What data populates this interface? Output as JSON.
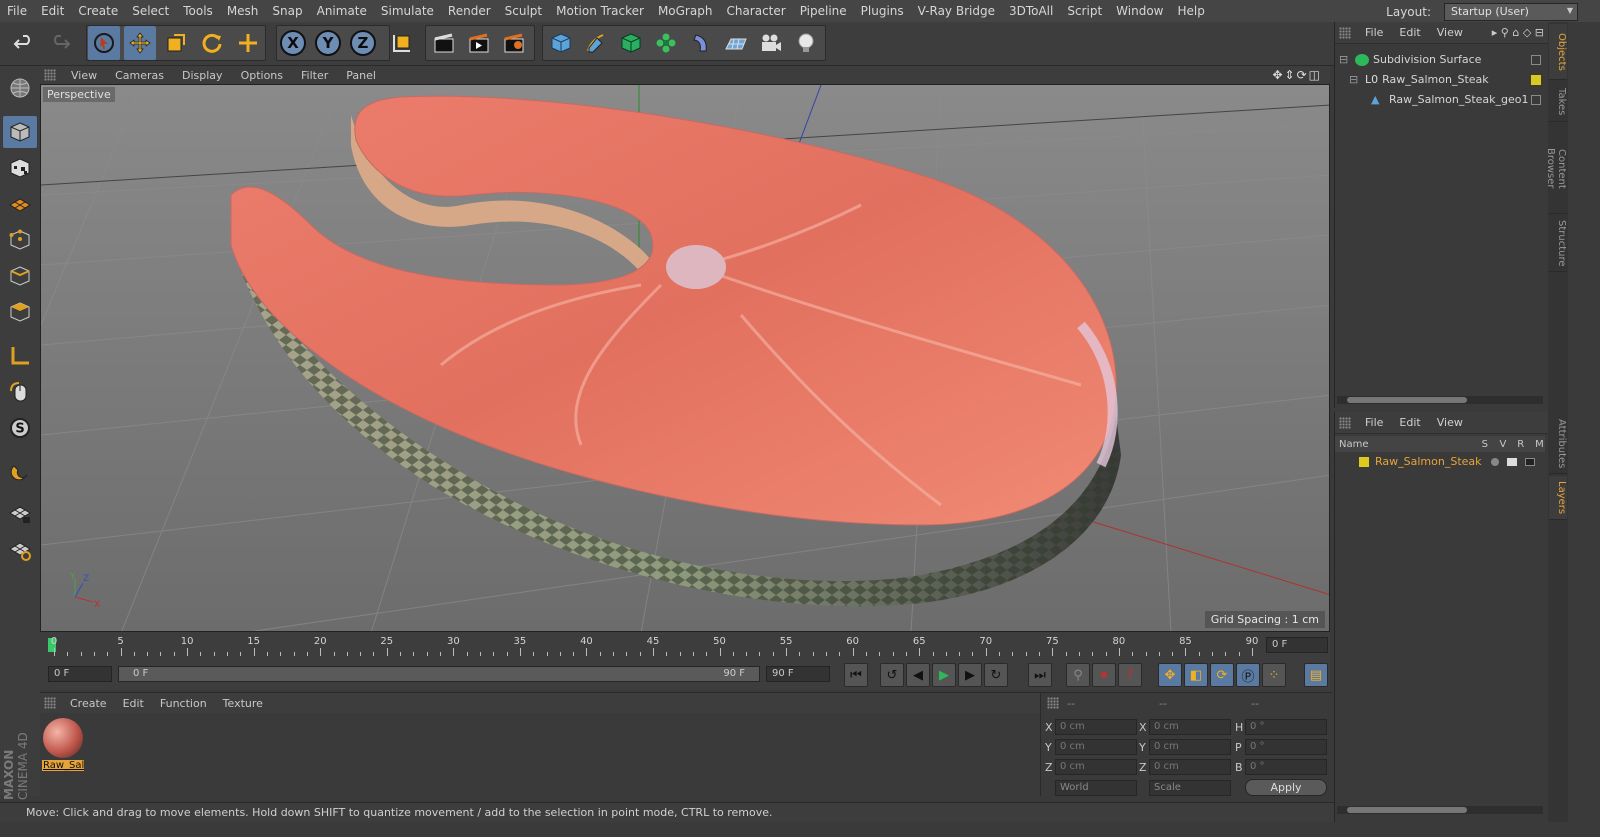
{
  "menu": [
    "File",
    "Edit",
    "Create",
    "Select",
    "Tools",
    "Mesh",
    "Snap",
    "Animate",
    "Simulate",
    "Render",
    "Sculpt",
    "Motion Tracker",
    "MoGraph",
    "Character",
    "Pipeline",
    "Plugins",
    "V-Ray Bridge",
    "3DToAll",
    "Script",
    "Window",
    "Help"
  ],
  "layout": {
    "label": "Layout:",
    "value": "Startup (User)"
  },
  "viewport": {
    "menu": [
      "View",
      "Cameras",
      "Display",
      "Options",
      "Filter",
      "Panel"
    ],
    "label": "Perspective",
    "grid_spacing": "Grid Spacing : 1 cm",
    "axis": {
      "y": "Y",
      "z": "Z",
      "x": "X"
    }
  },
  "timeline": {
    "ticks": [
      "0",
      "5",
      "10",
      "15",
      "20",
      "25",
      "30",
      "35",
      "40",
      "45",
      "50",
      "55",
      "60",
      "65",
      "70",
      "75",
      "80",
      "85",
      "90"
    ],
    "current_frame": "0 F",
    "start_frame": "0 F",
    "slider_start": "0 F",
    "slider_end": "90 F",
    "end_frame": "90 F"
  },
  "material_manager": {
    "menu": [
      "Create",
      "Edit",
      "Function",
      "Texture"
    ],
    "material_name": "Raw_Sal"
  },
  "coordinates": {
    "headers": [
      "--",
      "--",
      "--"
    ],
    "rows": [
      {
        "l1": "X",
        "v1": "0 cm",
        "l2": "X",
        "v2": "0 cm",
        "l3": "H",
        "v3": "0 °"
      },
      {
        "l1": "Y",
        "v1": "0 cm",
        "l2": "Y",
        "v2": "0 cm",
        "l3": "P",
        "v3": "0 °"
      },
      {
        "l1": "Z",
        "v1": "0 cm",
        "l2": "Z",
        "v2": "0 cm",
        "l3": "B",
        "v3": "0 °"
      }
    ],
    "mode": "World",
    "scale": "Scale",
    "apply": "Apply"
  },
  "objects_panel": {
    "menu": [
      "File",
      "Edit",
      "View"
    ],
    "items": [
      {
        "name": "Subdivision Surface",
        "icon": "subdivision-icon"
      },
      {
        "name": "Raw_Salmon_Steak",
        "icon": "null-object-icon"
      },
      {
        "name": "Raw_Salmon_Steak_geo1",
        "icon": "polygon-object-icon"
      }
    ]
  },
  "layers_panel": {
    "menu": [
      "File",
      "Edit",
      "View"
    ],
    "columns": [
      "Name",
      "S",
      "V",
      "R",
      "M"
    ],
    "items": [
      {
        "name": "Raw_Salmon_Steak",
        "color": "#e0c91e"
      }
    ]
  },
  "side_tabs": [
    "Objects",
    "Takes",
    "Content Browser",
    "Structure",
    "Attributes",
    "Layers"
  ],
  "status": "Move: Click and drag to move elements. Hold down SHIFT to quantize movement / add to the selection in point mode, CTRL to remove.",
  "logo": {
    "line1": "MAXON",
    "line2": "CINEMA 4D"
  },
  "colors": {
    "accent": "#5b7aa1",
    "layer": "#e0c91e",
    "highlight": "#e7a43a"
  }
}
